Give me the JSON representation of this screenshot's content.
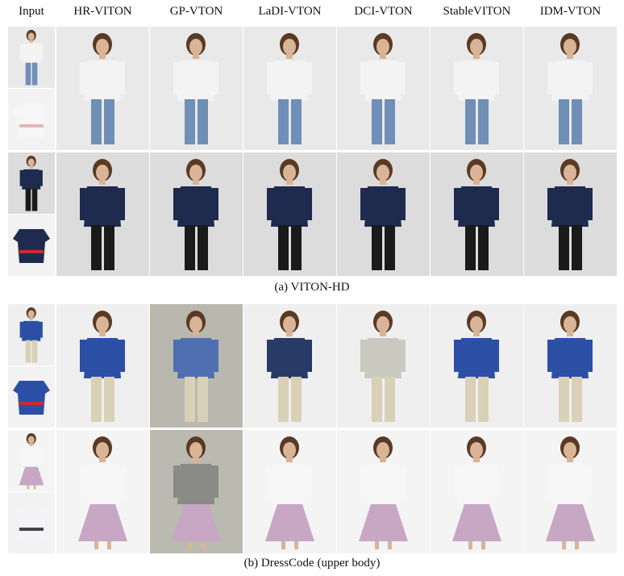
{
  "headers": {
    "input": "Input",
    "methods": [
      "HR-VITON",
      "GP-VTON",
      "LaDI-VTON",
      "DCI-VTON",
      "StableVITON",
      "IDM-VTON"
    ]
  },
  "captions": {
    "viton_hd": "(a) VITON-HD",
    "dresscode": "(b) DressCode (upper body)"
  },
  "panels": [
    {
      "name": "viton-hd",
      "rows": [
        {
          "person": "woman-jeans",
          "garment": "white-crop-tee",
          "bg": "#e9e9e9",
          "outputs": [
            "#f3f3f3",
            "#f3f3f3",
            "#f3f3f3",
            "#f3f3f3",
            "#f3f3f3",
            "#f3f3f3"
          ]
        },
        {
          "person": "woman-curly",
          "garment": "navy-jersey",
          "bg": "#dcdcdc",
          "outputs": [
            "#1f2a4f",
            "#1f2a4f",
            "#1f2a4f",
            "#1f2a4f",
            "#1f2a4f",
            "#1f2a4f"
          ]
        }
      ]
    },
    {
      "name": "dresscode",
      "rows": [
        {
          "person": "man-chinos",
          "garment": "blue-halfzip",
          "bg": "#efefef",
          "outputs": [
            "#2c4fa6",
            "#4f6fb0",
            "#2a3a66",
            "#c9c9c0",
            "#2c4fa6",
            "#2c4fa6"
          ]
        },
        {
          "person": "woman-skirt",
          "garment": "white-crop-sweater",
          "bg": "#f4f4f4",
          "outputs": [
            "#f6f6f6",
            "#8a8a86",
            "#f6f6f6",
            "#f6f6f6",
            "#f6f6f6",
            "#f6f6f6"
          ]
        }
      ]
    }
  ]
}
